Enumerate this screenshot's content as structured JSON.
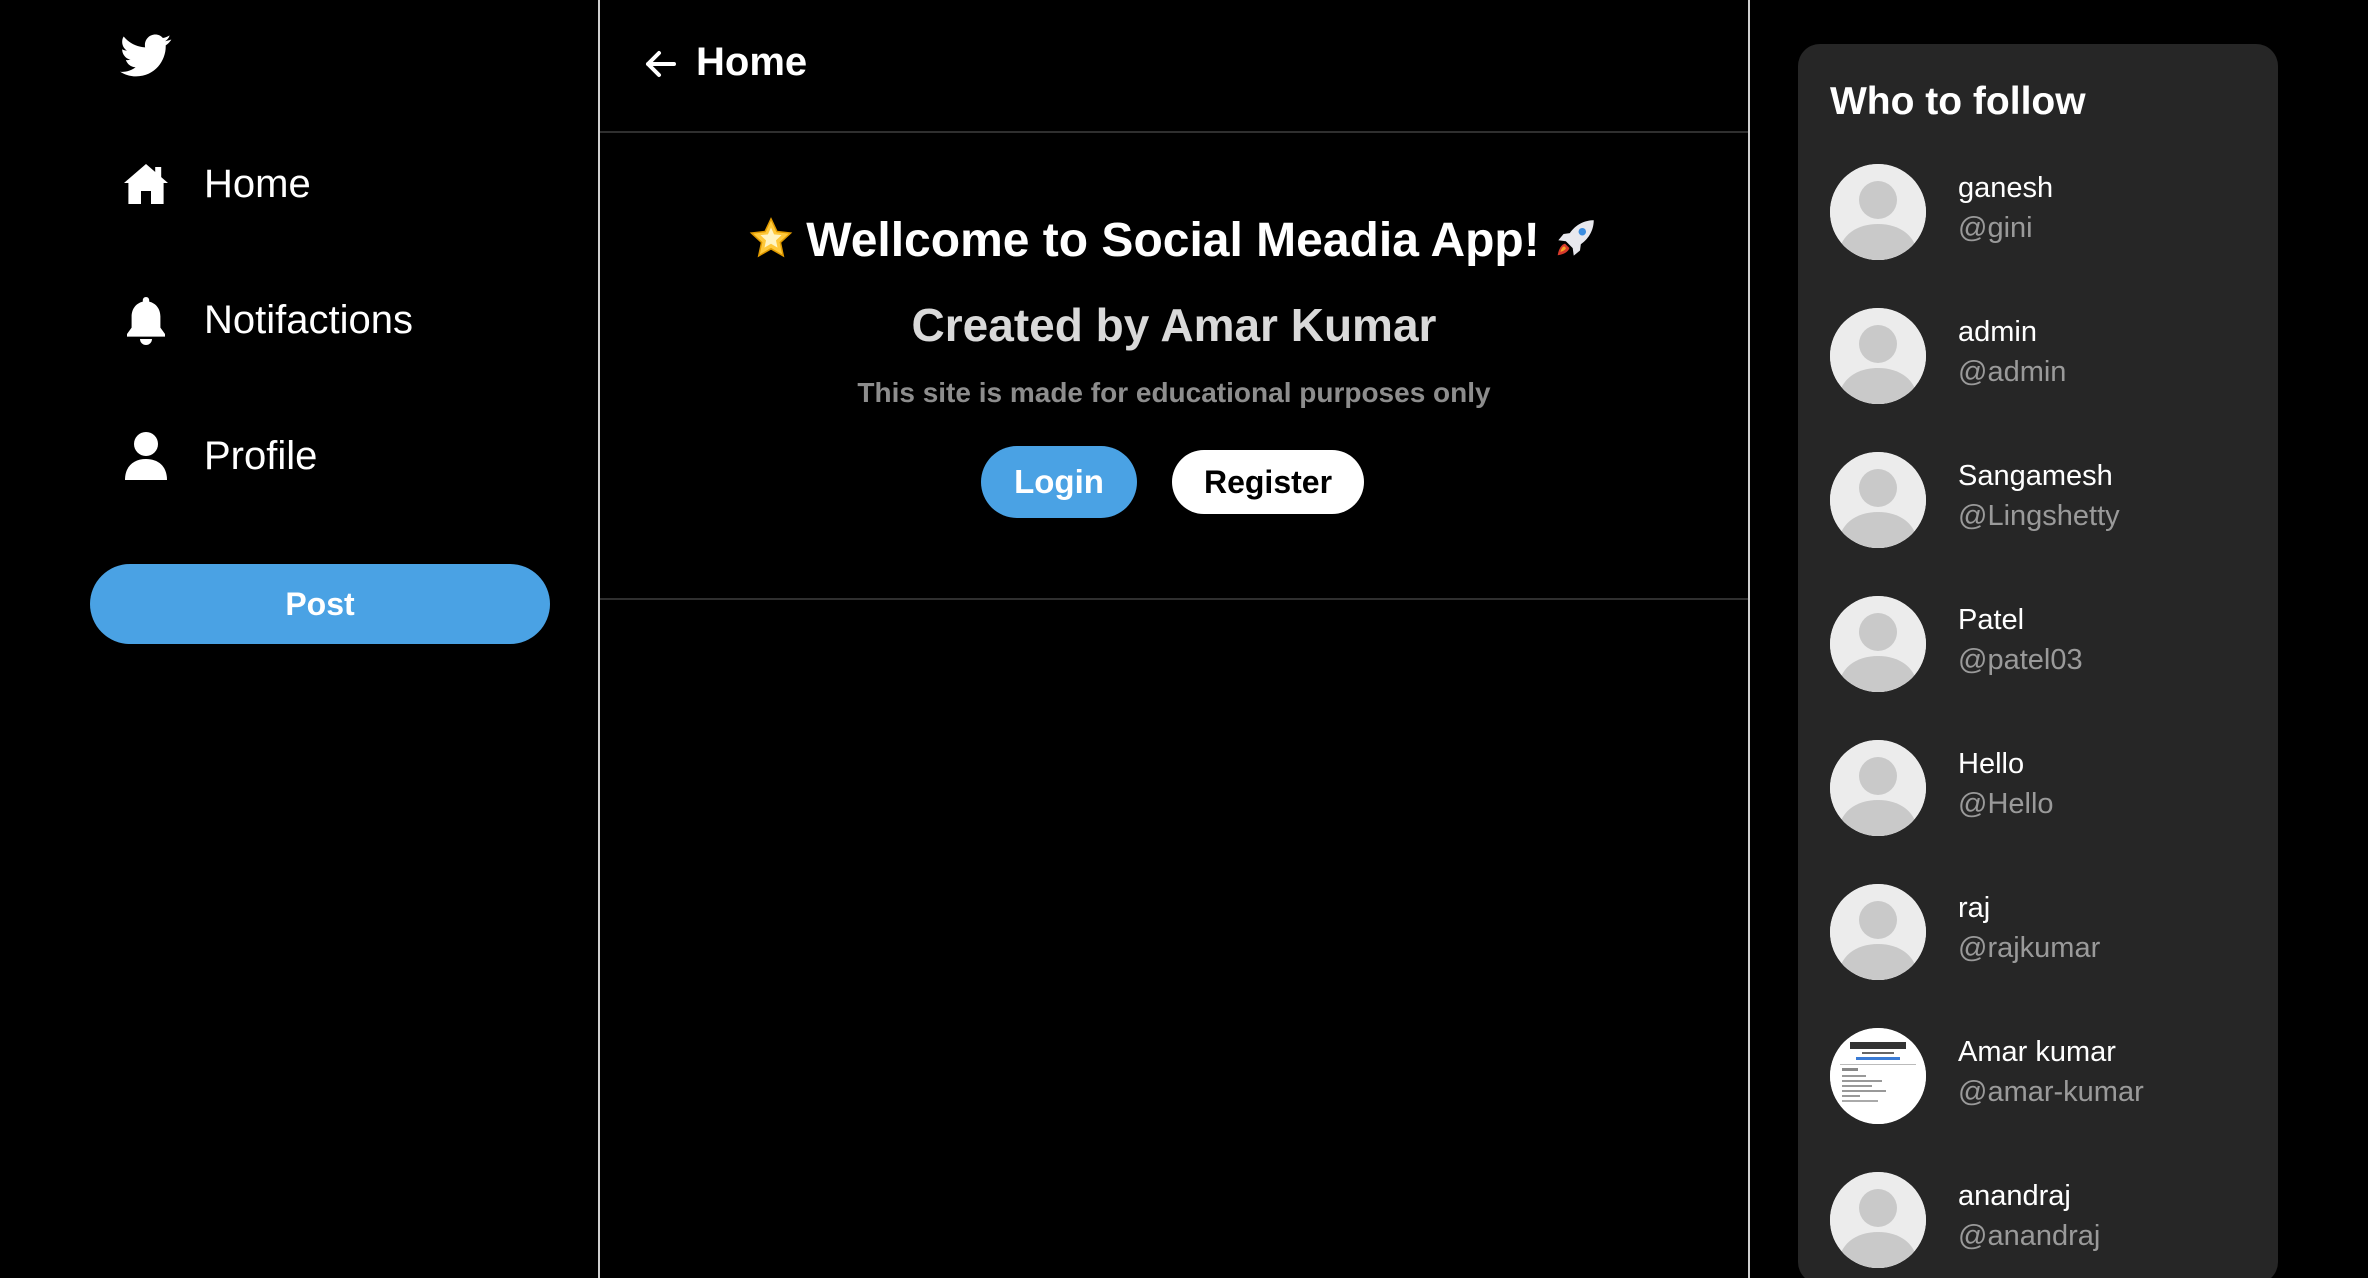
{
  "sidebar": {
    "logo_icon": "twitter-bird-icon",
    "items": [
      {
        "label": "Home",
        "icon": "home-icon"
      },
      {
        "label": "Notifactions",
        "icon": "bell-icon"
      },
      {
        "label": "Profile",
        "icon": "person-icon"
      }
    ],
    "post_label": "Post"
  },
  "header": {
    "back_icon": "arrow-left-icon",
    "title": "Home"
  },
  "welcome": {
    "title_emoji_left": "star-icon",
    "title": "Wellcome to Social Meadia App!",
    "title_emoji_right": "rocket-icon",
    "subtitle": "Created by Amar Kumar",
    "note": "This site is made for educational purposes only",
    "login_label": "Login",
    "register_label": "Register"
  },
  "follow": {
    "title": "Who to follow",
    "users": [
      {
        "name": "ganesh",
        "handle": "@gini"
      },
      {
        "name": "admin",
        "handle": "@admin"
      },
      {
        "name": "Sangamesh",
        "handle": "@Lingshetty"
      },
      {
        "name": "Patel",
        "handle": "@patel03"
      },
      {
        "name": "Hello",
        "handle": "@Hello"
      },
      {
        "name": "raj",
        "handle": "@rajkumar"
      },
      {
        "name": "Amar kumar",
        "handle": "@amar-kumar"
      },
      {
        "name": "anandraj",
        "handle": "@anandraj"
      }
    ]
  },
  "colors": {
    "accent": "#4aa2e4",
    "background": "#000000",
    "panel": "#262626",
    "muted": "#8d8d8d"
  }
}
